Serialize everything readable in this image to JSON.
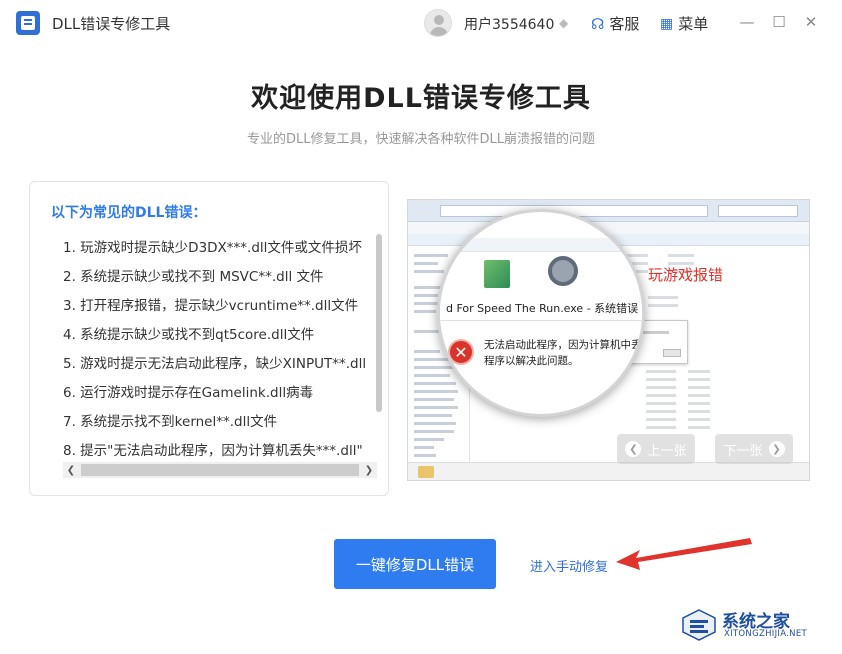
{
  "app": {
    "title": "DLL错误专修工具",
    "username": "用户3554640",
    "service_label": "客服",
    "menu_label": "菜单",
    "accent_color": "#2f7cf0",
    "icons": [
      "app-logo",
      "avatar",
      "vip-diamond-icon",
      "headset-icon",
      "grid-icon",
      "minimize-icon",
      "maximize-icon",
      "close-icon"
    ]
  },
  "header": {
    "title": "欢迎使用DLL错误专修工具",
    "subtitle": "专业的DLL修复工具，快速解决各种软件DLL崩溃报错的问题"
  },
  "errors_list": {
    "title": "以下为常见的DLL错误：",
    "items": [
      "1. 玩游戏时提示缺少D3DX***.dll文件或文件损坏",
      "2. 系统提示缺少或找不到 MSVC**.dll 文件",
      "3. 打开程序报错，提示缺少vcruntime**.dll文件",
      "4. 系统提示缺少或找不到qt5core.dll文件",
      "5. 游戏时提示无法启动此程序，缺少XINPUT**.dll",
      "6. 运行游戏时提示存在Gamelink.dll病毒",
      "7. 系统提示找不到kernel**.dll文件",
      "8. 提示\"无法启动此程序，因为计算机丢失***.dll\""
    ]
  },
  "preview": {
    "window_title": "d For Speed The Run.exe - 系统错误",
    "error_line1": "无法启动此程序，因为计算机中丢",
    "error_line2": "程序以解决此问题。",
    "caption": "玩游戏报错",
    "prev_label": "上一张",
    "next_label": "下一张",
    "error_color": "#e0332b"
  },
  "actions": {
    "fix_button": "一键修复DLL错误",
    "manual_link": "进入手动修复"
  },
  "watermark": {
    "text": "系统之家",
    "sub": "XITONGZHIJIA.NET"
  }
}
